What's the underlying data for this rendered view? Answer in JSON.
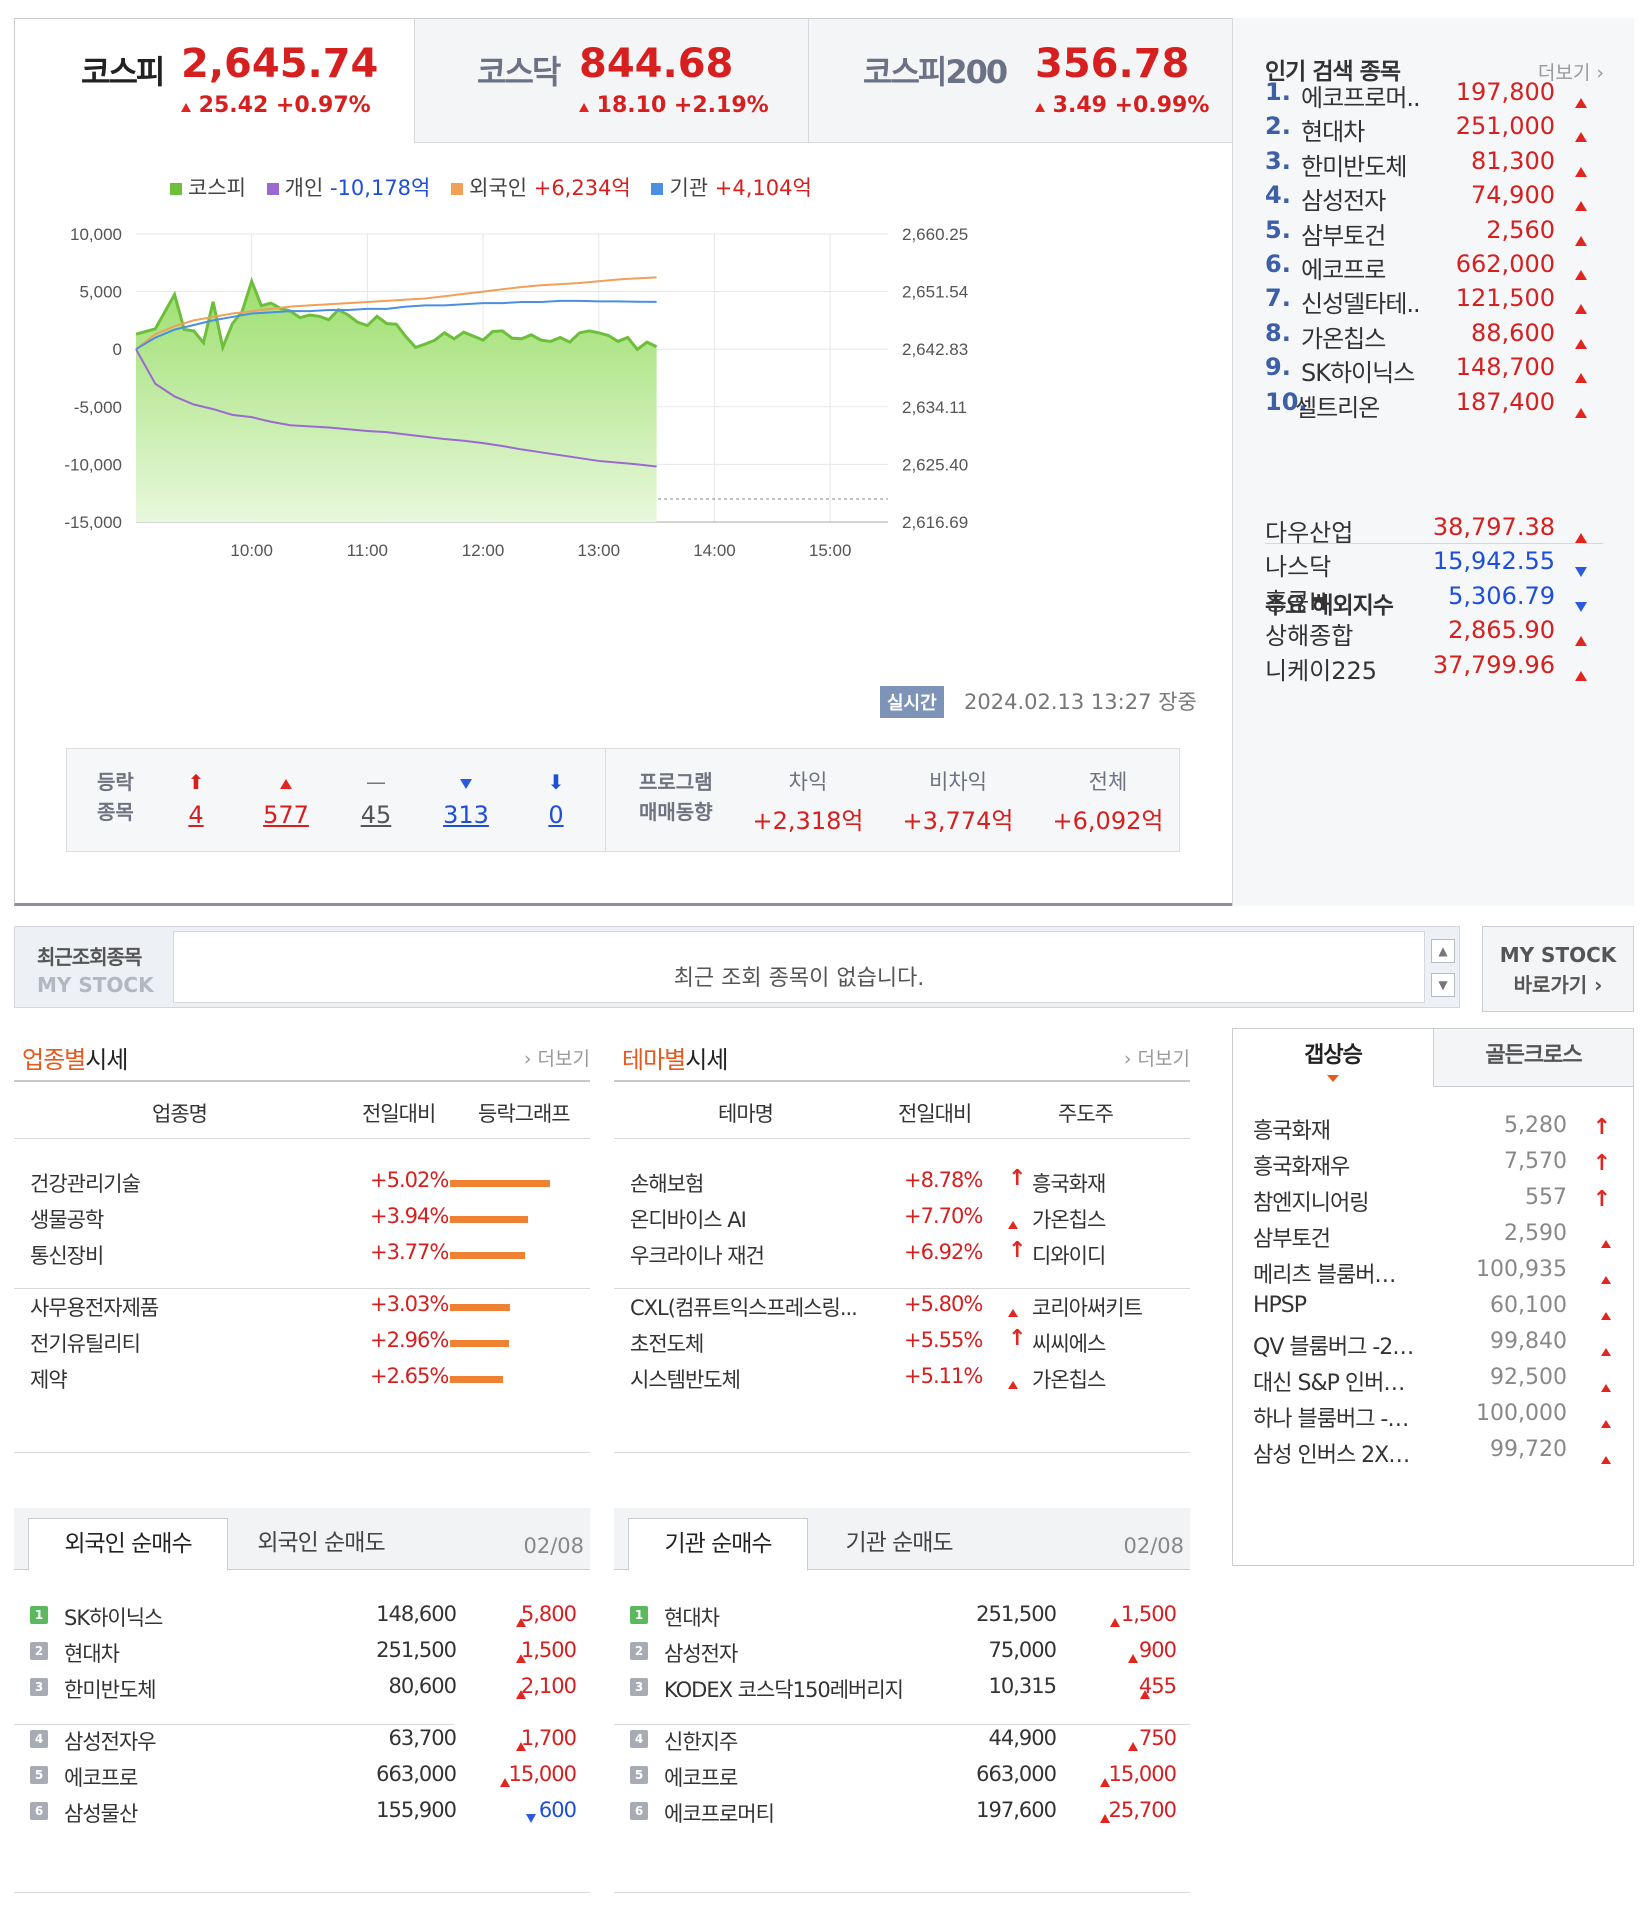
{
  "indices": [
    {
      "name": "코스피",
      "value": "2,645.74",
      "change": "25.42 +0.97%",
      "active": true
    },
    {
      "name": "코스닥",
      "value": "844.68",
      "change": "18.10 +2.19%",
      "active": false
    },
    {
      "name": "코스피200",
      "value": "356.78",
      "change": "3.49 +0.99%",
      "active": false
    }
  ],
  "legend": {
    "kospi_label": "코스피",
    "individual_label": "개인",
    "individual_value": "-10,178억",
    "foreign_label": "외국인",
    "foreign_value": "+6,234억",
    "institution_label": "기관",
    "institution_value": "+4,104억"
  },
  "colors": {
    "kospi": "#6dbf3b",
    "individual": "#9b6ad0",
    "foreign": "#f0a058",
    "institution": "#4a8fe0",
    "up": "#d61f1f",
    "down": "#1d4fd8",
    "accent": "#e65a1e"
  },
  "chart_data": {
    "type": "line",
    "xlim": [
      "09:00",
      "15:30"
    ],
    "x_ticks": [
      "10:00",
      "11:00",
      "12:00",
      "13:00",
      "14:00",
      "15:00"
    ],
    "y_left_ticks": [
      "10,000",
      "5,000",
      "0",
      "-5,000",
      "-10,000",
      "-15,000"
    ],
    "y_left_range": [
      -15000,
      10000
    ],
    "y_right_ticks": [
      "2,660.25",
      "2,651.54",
      "2,642.83",
      "2,634.11",
      "2,625.40",
      "2,616.69"
    ],
    "y_right_range": [
      2616.69,
      2660.25
    ],
    "baseline_dotted": -13000,
    "series": [
      {
        "name": "코스피",
        "axis": "right",
        "style": "area",
        "x": [
          0,
          10,
          20,
          25,
          30,
          35,
          40,
          45,
          50,
          55,
          60,
          65,
          70,
          75,
          80,
          85,
          90,
          95,
          100,
          105,
          110,
          115,
          120,
          125,
          130,
          135,
          140,
          145,
          150,
          155,
          160,
          165,
          170,
          175,
          180,
          185,
          190,
          195,
          200,
          205,
          210,
          215,
          220,
          225,
          230,
          235,
          240,
          245,
          250,
          255,
          260,
          265,
          270
        ],
        "y": [
          2645.1,
          2645.9,
          2651.1,
          2645.8,
          2645.6,
          2643.8,
          2650.0,
          2643.1,
          2646.7,
          2648.5,
          2653.1,
          2649.4,
          2649.8,
          2649.0,
          2648.6,
          2647.6,
          2648.0,
          2647.8,
          2647.3,
          2648.8,
          2648.0,
          2646.9,
          2646.4,
          2647.8,
          2646.7,
          2646.6,
          2644.7,
          2643.1,
          2643.6,
          2644.2,
          2645.3,
          2644.4,
          2645.4,
          2644.8,
          2644.2,
          2645.5,
          2645.6,
          2644.5,
          2644.4,
          2645.0,
          2644.2,
          2644.0,
          2644.6,
          2643.9,
          2645.3,
          2645.6,
          2645.3,
          2644.9,
          2644.0,
          2644.6,
          2642.8,
          2643.9,
          2643.2
        ]
      },
      {
        "name": "개인",
        "axis": "left",
        "x": [
          0,
          10,
          20,
          30,
          40,
          50,
          60,
          70,
          80,
          90,
          100,
          110,
          120,
          130,
          140,
          150,
          160,
          170,
          180,
          190,
          200,
          210,
          220,
          230,
          240,
          250,
          260,
          270
        ],
        "y": [
          0,
          -3000,
          -4100,
          -4800,
          -5200,
          -5700,
          -5900,
          -6300,
          -6600,
          -6700,
          -6800,
          -6950,
          -7100,
          -7200,
          -7400,
          -7600,
          -7800,
          -7950,
          -8150,
          -8400,
          -8700,
          -8950,
          -9200,
          -9450,
          -9700,
          -9850,
          -10000,
          -10178
        ]
      },
      {
        "name": "외국인",
        "axis": "left",
        "x": [
          0,
          10,
          20,
          30,
          40,
          50,
          60,
          70,
          80,
          90,
          100,
          110,
          120,
          130,
          140,
          150,
          160,
          170,
          180,
          190,
          200,
          210,
          220,
          230,
          240,
          250,
          260,
          270
        ],
        "y": [
          0,
          1300,
          2000,
          2500,
          2800,
          3100,
          3300,
          3500,
          3700,
          3800,
          3900,
          4000,
          4100,
          4200,
          4300,
          4400,
          4600,
          4800,
          5000,
          5200,
          5400,
          5550,
          5650,
          5750,
          5900,
          6050,
          6150,
          6234
        ]
      },
      {
        "name": "기관",
        "axis": "left",
        "x": [
          0,
          10,
          20,
          30,
          40,
          50,
          60,
          70,
          80,
          90,
          100,
          110,
          120,
          130,
          140,
          150,
          160,
          170,
          180,
          190,
          200,
          210,
          220,
          230,
          240,
          250,
          260,
          270
        ],
        "y": [
          0,
          1000,
          1700,
          2100,
          2500,
          2800,
          3100,
          3200,
          3300,
          3300,
          3400,
          3400,
          3500,
          3500,
          3700,
          3800,
          3800,
          3900,
          4000,
          4000,
          4100,
          4100,
          4200,
          4200,
          4150,
          4150,
          4120,
          4104
        ]
      }
    ]
  },
  "realtime": {
    "badge": "실시간",
    "timestamp": "2024.02.13 13:27",
    "status": "장중"
  },
  "stats": {
    "label_line1": "등락",
    "label_line2": "종목",
    "upper_limit": "4",
    "rise": "577",
    "flat": "45",
    "fall": "313",
    "lower_limit": "0",
    "program_line1": "프로그램",
    "program_line2": "매매동향",
    "arbitrage_label": "차익",
    "arbitrage_value": "+2,318억",
    "nonarb_label": "비차익",
    "nonarb_value": "+3,774억",
    "total_label": "전체",
    "total_value": "+6,092억"
  },
  "popular": {
    "title": "인기 검색 종목",
    "more": "더보기",
    "items": [
      {
        "rank": "1.",
        "name": "에코프로머..",
        "price": "197,800"
      },
      {
        "rank": "2.",
        "name": "현대차",
        "price": "251,000"
      },
      {
        "rank": "3.",
        "name": "한미반도체",
        "price": "81,300"
      },
      {
        "rank": "4.",
        "name": "삼성전자",
        "price": "74,900"
      },
      {
        "rank": "5.",
        "name": "삼부토건",
        "price": "2,560"
      },
      {
        "rank": "6.",
        "name": "에코프로",
        "price": "662,000"
      },
      {
        "rank": "7.",
        "name": "신성델타테..",
        "price": "121,500"
      },
      {
        "rank": "8.",
        "name": "가온칩스",
        "price": "88,600"
      },
      {
        "rank": "9.",
        "name": "SK하이닉스",
        "price": "148,700"
      },
      {
        "rank": "10.",
        "name": "셀트리온",
        "price": "187,400"
      }
    ]
  },
  "overseas": {
    "title": "주요 해외지수",
    "items": [
      {
        "name": "다우산업",
        "value": "38,797.38",
        "dir": "up"
      },
      {
        "name": "나스닥",
        "value": "15,942.55",
        "dir": "down"
      },
      {
        "name": "홍콩H",
        "value": "5,306.79",
        "dir": "down"
      },
      {
        "name": "상해종합",
        "value": "2,865.90",
        "dir": "up"
      },
      {
        "name": "니케이225",
        "value": "37,799.96",
        "dir": "up"
      }
    ]
  },
  "recent": {
    "label1": "최근조회종목",
    "label2": "MY STOCK",
    "empty_message": "최근 조회 종목이 없습니다.",
    "mystock_line1": "MY STOCK",
    "mystock_line2": "바로가기"
  },
  "sector": {
    "title_hl": "업종별",
    "title_rest": "시세",
    "more": "더보기",
    "headers": [
      "업종명",
      "전일대비",
      "등락그래프"
    ],
    "rows": [
      {
        "name": "건강관리기술",
        "change": "+5.02%",
        "pct": 5.02
      },
      {
        "name": "생물공학",
        "change": "+3.94%",
        "pct": 3.94
      },
      {
        "name": "통신장비",
        "change": "+3.77%",
        "pct": 3.77
      },
      {
        "name": "사무용전자제품",
        "change": "+3.03%",
        "pct": 3.03
      },
      {
        "name": "전기유틸리티",
        "change": "+2.96%",
        "pct": 2.96
      },
      {
        "name": "제약",
        "change": "+2.65%",
        "pct": 2.65
      }
    ]
  },
  "theme": {
    "title_hl": "테마별",
    "title_rest": "시세",
    "more": "더보기",
    "headers": [
      "테마명",
      "전일대비",
      "주도주"
    ],
    "rows": [
      {
        "name": "손해보험",
        "change": "+8.78%",
        "lead": "흥국화재",
        "mark": "limit"
      },
      {
        "name": "온디바이스 AI",
        "change": "+7.70%",
        "lead": "가온칩스",
        "mark": "up"
      },
      {
        "name": "우크라이나 재건",
        "change": "+6.92%",
        "lead": "디와이디",
        "mark": "limit"
      },
      {
        "name": "CXL(컴퓨트익스프레스링...",
        "change": "+5.80%",
        "lead": "코리아써키트",
        "mark": "up"
      },
      {
        "name": "초전도체",
        "change": "+5.55%",
        "lead": "씨씨에스",
        "mark": "limit"
      },
      {
        "name": "시스템반도체",
        "change": "+5.11%",
        "lead": "가온칩스",
        "mark": "up"
      }
    ]
  },
  "gap": {
    "tab_active": "갭상승",
    "tab_inactive": "골든크로스",
    "rows": [
      {
        "name": "흥국화재",
        "price": "5,280",
        "mark": "limit"
      },
      {
        "name": "흥국화재우",
        "price": "7,570",
        "mark": "limit"
      },
      {
        "name": "참엔지니어링",
        "price": "557",
        "mark": "limit"
      },
      {
        "name": "삼부토건",
        "price": "2,590",
        "mark": "up"
      },
      {
        "name": "메리츠 블룸버…",
        "price": "100,935",
        "mark": "up"
      },
      {
        "name": "HPSP",
        "price": "60,100",
        "mark": "up"
      },
      {
        "name": "QV 블룸버그 -2…",
        "price": "99,840",
        "mark": "up"
      },
      {
        "name": "대신 S&P 인버…",
        "price": "92,500",
        "mark": "up"
      },
      {
        "name": "하나 블룸버그 -…",
        "price": "100,000",
        "mark": "up"
      },
      {
        "name": "삼성 인버스 2X…",
        "price": "99,720",
        "mark": "up"
      }
    ]
  },
  "foreign": {
    "tab_active": "외국인 순매수",
    "tab_inactive": "외국인 순매도",
    "date": "02/08",
    "rows": [
      {
        "rank": "1",
        "name": "SK하이닉스",
        "price": "148,600",
        "change": "5,800",
        "dir": "up"
      },
      {
        "rank": "2",
        "name": "현대차",
        "price": "251,500",
        "change": "1,500",
        "dir": "up"
      },
      {
        "rank": "3",
        "name": "한미반도체",
        "price": "80,600",
        "change": "2,100",
        "dir": "up"
      },
      {
        "rank": "4",
        "name": "삼성전자우",
        "price": "63,700",
        "change": "1,700",
        "dir": "up"
      },
      {
        "rank": "5",
        "name": "에코프로",
        "price": "663,000",
        "change": "15,000",
        "dir": "up"
      },
      {
        "rank": "6",
        "name": "삼성물산",
        "price": "155,900",
        "change": "600",
        "dir": "down"
      }
    ]
  },
  "institution": {
    "tab_active": "기관 순매수",
    "tab_inactive": "기관 순매도",
    "date": "02/08",
    "rows": [
      {
        "rank": "1",
        "name": "현대차",
        "price": "251,500",
        "change": "1,500",
        "dir": "up"
      },
      {
        "rank": "2",
        "name": "삼성전자",
        "price": "75,000",
        "change": "900",
        "dir": "up"
      },
      {
        "rank": "3",
        "name": "KODEX 코스닥150레버리지",
        "price": "10,315",
        "change": "455",
        "dir": "up"
      },
      {
        "rank": "4",
        "name": "신한지주",
        "price": "44,900",
        "change": "750",
        "dir": "up"
      },
      {
        "rank": "5",
        "name": "에코프로",
        "price": "663,000",
        "change": "15,000",
        "dir": "up"
      },
      {
        "rank": "6",
        "name": "에코프로머티",
        "price": "197,600",
        "change": "25,700",
        "dir": "up"
      }
    ]
  }
}
